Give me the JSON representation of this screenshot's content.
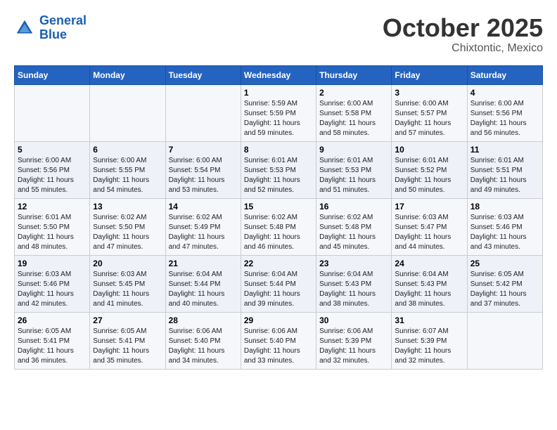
{
  "header": {
    "logo_line1": "General",
    "logo_line2": "Blue",
    "month": "October 2025",
    "location": "Chixtontic, Mexico"
  },
  "weekdays": [
    "Sunday",
    "Monday",
    "Tuesday",
    "Wednesday",
    "Thursday",
    "Friday",
    "Saturday"
  ],
  "weeks": [
    [
      {
        "day": "",
        "info": ""
      },
      {
        "day": "",
        "info": ""
      },
      {
        "day": "",
        "info": ""
      },
      {
        "day": "1",
        "info": "Sunrise: 5:59 AM\nSunset: 5:59 PM\nDaylight: 11 hours and 59 minutes."
      },
      {
        "day": "2",
        "info": "Sunrise: 6:00 AM\nSunset: 5:58 PM\nDaylight: 11 hours and 58 minutes."
      },
      {
        "day": "3",
        "info": "Sunrise: 6:00 AM\nSunset: 5:57 PM\nDaylight: 11 hours and 57 minutes."
      },
      {
        "day": "4",
        "info": "Sunrise: 6:00 AM\nSunset: 5:56 PM\nDaylight: 11 hours and 56 minutes."
      }
    ],
    [
      {
        "day": "5",
        "info": "Sunrise: 6:00 AM\nSunset: 5:56 PM\nDaylight: 11 hours and 55 minutes."
      },
      {
        "day": "6",
        "info": "Sunrise: 6:00 AM\nSunset: 5:55 PM\nDaylight: 11 hours and 54 minutes."
      },
      {
        "day": "7",
        "info": "Sunrise: 6:00 AM\nSunset: 5:54 PM\nDaylight: 11 hours and 53 minutes."
      },
      {
        "day": "8",
        "info": "Sunrise: 6:01 AM\nSunset: 5:53 PM\nDaylight: 11 hours and 52 minutes."
      },
      {
        "day": "9",
        "info": "Sunrise: 6:01 AM\nSunset: 5:53 PM\nDaylight: 11 hours and 51 minutes."
      },
      {
        "day": "10",
        "info": "Sunrise: 6:01 AM\nSunset: 5:52 PM\nDaylight: 11 hours and 50 minutes."
      },
      {
        "day": "11",
        "info": "Sunrise: 6:01 AM\nSunset: 5:51 PM\nDaylight: 11 hours and 49 minutes."
      }
    ],
    [
      {
        "day": "12",
        "info": "Sunrise: 6:01 AM\nSunset: 5:50 PM\nDaylight: 11 hours and 48 minutes."
      },
      {
        "day": "13",
        "info": "Sunrise: 6:02 AM\nSunset: 5:50 PM\nDaylight: 11 hours and 47 minutes."
      },
      {
        "day": "14",
        "info": "Sunrise: 6:02 AM\nSunset: 5:49 PM\nDaylight: 11 hours and 47 minutes."
      },
      {
        "day": "15",
        "info": "Sunrise: 6:02 AM\nSunset: 5:48 PM\nDaylight: 11 hours and 46 minutes."
      },
      {
        "day": "16",
        "info": "Sunrise: 6:02 AM\nSunset: 5:48 PM\nDaylight: 11 hours and 45 minutes."
      },
      {
        "day": "17",
        "info": "Sunrise: 6:03 AM\nSunset: 5:47 PM\nDaylight: 11 hours and 44 minutes."
      },
      {
        "day": "18",
        "info": "Sunrise: 6:03 AM\nSunset: 5:46 PM\nDaylight: 11 hours and 43 minutes."
      }
    ],
    [
      {
        "day": "19",
        "info": "Sunrise: 6:03 AM\nSunset: 5:46 PM\nDaylight: 11 hours and 42 minutes."
      },
      {
        "day": "20",
        "info": "Sunrise: 6:03 AM\nSunset: 5:45 PM\nDaylight: 11 hours and 41 minutes."
      },
      {
        "day": "21",
        "info": "Sunrise: 6:04 AM\nSunset: 5:44 PM\nDaylight: 11 hours and 40 minutes."
      },
      {
        "day": "22",
        "info": "Sunrise: 6:04 AM\nSunset: 5:44 PM\nDaylight: 11 hours and 39 minutes."
      },
      {
        "day": "23",
        "info": "Sunrise: 6:04 AM\nSunset: 5:43 PM\nDaylight: 11 hours and 38 minutes."
      },
      {
        "day": "24",
        "info": "Sunrise: 6:04 AM\nSunset: 5:43 PM\nDaylight: 11 hours and 38 minutes."
      },
      {
        "day": "25",
        "info": "Sunrise: 6:05 AM\nSunset: 5:42 PM\nDaylight: 11 hours and 37 minutes."
      }
    ],
    [
      {
        "day": "26",
        "info": "Sunrise: 6:05 AM\nSunset: 5:41 PM\nDaylight: 11 hours and 36 minutes."
      },
      {
        "day": "27",
        "info": "Sunrise: 6:05 AM\nSunset: 5:41 PM\nDaylight: 11 hours and 35 minutes."
      },
      {
        "day": "28",
        "info": "Sunrise: 6:06 AM\nSunset: 5:40 PM\nDaylight: 11 hours and 34 minutes."
      },
      {
        "day": "29",
        "info": "Sunrise: 6:06 AM\nSunset: 5:40 PM\nDaylight: 11 hours and 33 minutes."
      },
      {
        "day": "30",
        "info": "Sunrise: 6:06 AM\nSunset: 5:39 PM\nDaylight: 11 hours and 32 minutes."
      },
      {
        "day": "31",
        "info": "Sunrise: 6:07 AM\nSunset: 5:39 PM\nDaylight: 11 hours and 32 minutes."
      },
      {
        "day": "",
        "info": ""
      }
    ]
  ]
}
